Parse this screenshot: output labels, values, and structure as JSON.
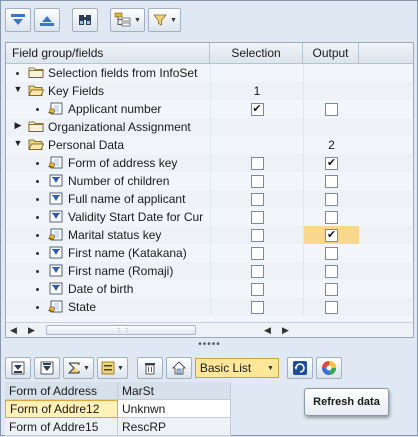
{
  "toolbar": {
    "buttons": [
      {
        "icon": "expand-all-icon"
      },
      {
        "icon": "collapse-all-icon"
      },
      {
        "icon": "find-icon"
      },
      {
        "icon": "tree-structure-icon"
      },
      {
        "icon": "filter-icon"
      }
    ]
  },
  "tree": {
    "headers": {
      "fields": "Field group/fields",
      "selection": "Selection",
      "output": "Output"
    },
    "rows": [
      {
        "label": "Selection fields from InfoSet",
        "level": 0,
        "kind": "folder",
        "expander": "none",
        "selection": "",
        "output": ""
      },
      {
        "label": "Key Fields",
        "level": 0,
        "kind": "folder-open",
        "expander": "open",
        "selection": "1",
        "output": ""
      },
      {
        "label": "Applicant number",
        "level": 1,
        "kind": "key-field",
        "expander": "none",
        "selection": "checked",
        "output": "unchecked"
      },
      {
        "label": "Organizational Assignment",
        "level": 0,
        "kind": "folder",
        "expander": "closed",
        "selection": "",
        "output": ""
      },
      {
        "label": "Personal Data",
        "level": 0,
        "kind": "folder-open",
        "expander": "open",
        "selection": "",
        "output": "2"
      },
      {
        "label": "Form of address key",
        "level": 1,
        "kind": "key-field",
        "expander": "none",
        "selection": "unchecked",
        "output": "checked"
      },
      {
        "label": "Number of children",
        "level": 1,
        "kind": "field",
        "expander": "none",
        "selection": "unchecked",
        "output": "unchecked"
      },
      {
        "label": "Full name of applicant",
        "level": 1,
        "kind": "field",
        "expander": "none",
        "selection": "unchecked",
        "output": "unchecked"
      },
      {
        "label": "Validity Start Date for Cur",
        "level": 1,
        "kind": "field",
        "expander": "none",
        "selection": "unchecked",
        "output": "unchecked"
      },
      {
        "label": "Marital status key",
        "level": 1,
        "kind": "key-field",
        "expander": "none",
        "selection": "unchecked",
        "output": "checked",
        "highlight_output": true
      },
      {
        "label": "First name (Katakana)",
        "level": 1,
        "kind": "field",
        "expander": "none",
        "selection": "unchecked",
        "output": "unchecked"
      },
      {
        "label": "First name (Romaji)",
        "level": 1,
        "kind": "field",
        "expander": "none",
        "selection": "unchecked",
        "output": "unchecked"
      },
      {
        "label": "Date of birth",
        "level": 1,
        "kind": "field",
        "expander": "none",
        "selection": "unchecked",
        "output": "unchecked"
      },
      {
        "label": "State",
        "level": 1,
        "kind": "key-field",
        "expander": "none",
        "selection": "unchecked",
        "output": "unchecked"
      }
    ]
  },
  "alv": {
    "layout_select": "Basic List",
    "columns": [
      "Form of Address",
      "MarSt"
    ],
    "rows": [
      [
        "Form of Addre12",
        "Unknwn"
      ],
      [
        "Form of Addre15",
        "RescRP"
      ]
    ],
    "tooltip": "Refresh data"
  },
  "colors": {
    "highlight": "#f9d88d",
    "panel": "#dfe8f3"
  }
}
